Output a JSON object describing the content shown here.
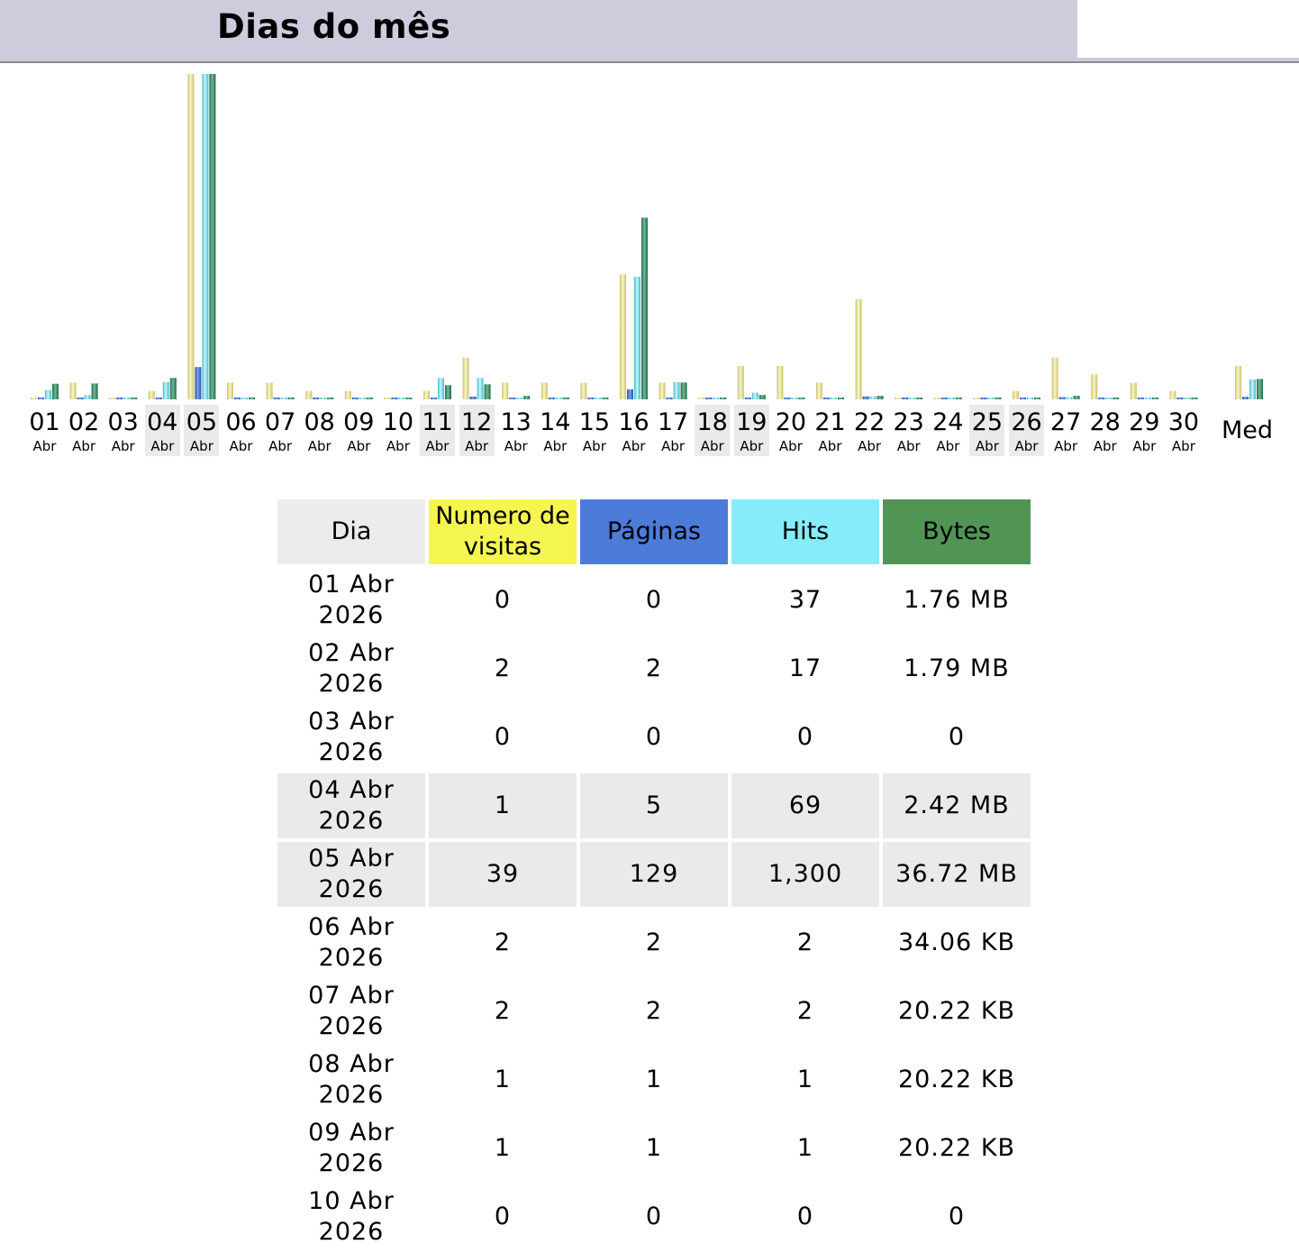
{
  "header": {
    "title": "Dias do mês"
  },
  "chart_data": {
    "type": "bar",
    "categories": [
      "01",
      "02",
      "03",
      "04",
      "05",
      "06",
      "07",
      "08",
      "09",
      "10",
      "11",
      "12",
      "13",
      "14",
      "15",
      "16",
      "17",
      "18",
      "19",
      "20",
      "21",
      "22",
      "23",
      "24",
      "25",
      "26",
      "27",
      "28",
      "29",
      "30",
      "Med"
    ],
    "month_label": "Abr",
    "weekend_days": [
      "04",
      "05",
      "11",
      "12",
      "18",
      "19",
      "25",
      "26"
    ],
    "series": [
      {
        "name": "Numero de visitas",
        "color": "#ecec9e",
        "values": [
          0,
          2,
          0,
          1,
          39,
          2,
          2,
          1,
          1,
          0,
          1,
          5,
          2,
          2,
          2,
          15,
          2,
          0,
          4,
          4,
          2,
          12,
          0,
          0,
          0,
          1,
          5,
          3,
          2,
          1,
          4
        ]
      },
      {
        "name": "Páginas",
        "color": "#4c7bd9",
        "values": [
          0,
          2,
          0,
          5,
          129,
          2,
          2,
          1,
          1,
          0,
          1,
          11,
          2,
          2,
          2,
          40,
          2,
          0,
          6,
          4,
          2,
          12,
          0,
          0,
          0,
          1,
          9,
          3,
          2,
          1,
          10
        ]
      },
      {
        "name": "Hits",
        "color": "#86ecfa",
        "values": [
          37,
          17,
          0,
          69,
          1300,
          2,
          2,
          1,
          1,
          0,
          85,
          85,
          7,
          2,
          2,
          490,
          69,
          0,
          27,
          4,
          2,
          12,
          0,
          0,
          0,
          1,
          9,
          3,
          2,
          1,
          80
        ]
      },
      {
        "name": "Bytes",
        "color": "#519554",
        "values_mb": [
          1.76,
          1.79,
          0,
          2.42,
          36.72,
          0.03,
          0.02,
          0.02,
          0.02,
          0,
          1.6,
          1.7,
          0.4,
          0.02,
          0.02,
          20.5,
          1.9,
          0,
          0.5,
          0.1,
          0.1,
          0.4,
          0,
          0,
          0.1,
          0.1,
          0.4,
          0.1,
          0.1,
          0.1,
          2.3
        ]
      }
    ]
  },
  "table": {
    "headers": {
      "day": "Dia",
      "visits": "Numero de visitas",
      "pages": "Páginas",
      "hits": "Hits",
      "bytes": "Bytes"
    },
    "rows": [
      {
        "day": "01 Abr 2026",
        "visits": "0",
        "pages": "0",
        "hits": "37",
        "bytes": "1.76 MB",
        "weekend": false
      },
      {
        "day": "02 Abr 2026",
        "visits": "2",
        "pages": "2",
        "hits": "17",
        "bytes": "1.79 MB",
        "weekend": false
      },
      {
        "day": "03 Abr 2026",
        "visits": "0",
        "pages": "0",
        "hits": "0",
        "bytes": "0",
        "weekend": false
      },
      {
        "day": "04 Abr 2026",
        "visits": "1",
        "pages": "5",
        "hits": "69",
        "bytes": "2.42 MB",
        "weekend": true
      },
      {
        "day": "05 Abr 2026",
        "visits": "39",
        "pages": "129",
        "hits": "1,300",
        "bytes": "36.72 MB",
        "weekend": true
      },
      {
        "day": "06 Abr 2026",
        "visits": "2",
        "pages": "2",
        "hits": "2",
        "bytes": "34.06 KB",
        "weekend": false
      },
      {
        "day": "07 Abr 2026",
        "visits": "2",
        "pages": "2",
        "hits": "2",
        "bytes": "20.22 KB",
        "weekend": false
      },
      {
        "day": "08 Abr 2026",
        "visits": "1",
        "pages": "1",
        "hits": "1",
        "bytes": "20.22 KB",
        "weekend": false
      },
      {
        "day": "09 Abr 2026",
        "visits": "1",
        "pages": "1",
        "hits": "1",
        "bytes": "20.22 KB",
        "weekend": false
      },
      {
        "day": "10 Abr 2026",
        "visits": "0",
        "pages": "0",
        "hits": "0",
        "bytes": "0",
        "weekend": false
      }
    ]
  }
}
